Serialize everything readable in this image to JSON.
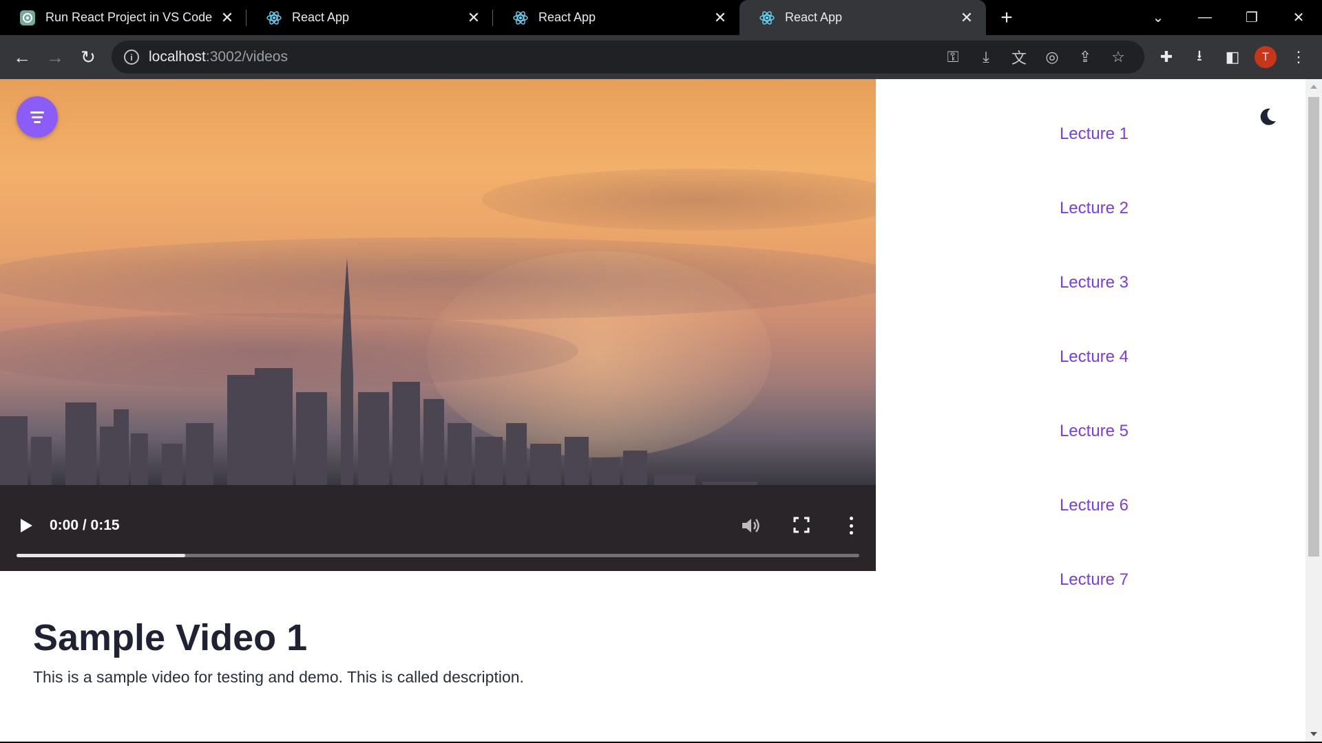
{
  "browser": {
    "tabs": [
      {
        "title": "Run React Project in VS Code",
        "icon": "chatgpt-icon",
        "active": false
      },
      {
        "title": "React App",
        "icon": "react-icon",
        "active": false
      },
      {
        "title": "React App",
        "icon": "react-icon",
        "active": false
      },
      {
        "title": "React App",
        "icon": "react-icon",
        "active": true
      }
    ],
    "new_tab_label": "+",
    "url_host": "localhost",
    "url_path": ":3002/videos",
    "profile_initial": "T",
    "accent_color": "#c8361a"
  },
  "page": {
    "video": {
      "time_display": "0:00 / 0:15",
      "progress_fraction": 0.2
    },
    "video_title": "Sample Video 1",
    "video_description": "This is a sample video for testing and demo. This is called description.",
    "lectures": [
      {
        "label": "Lecture 1"
      },
      {
        "label": "Lecture 2"
      },
      {
        "label": "Lecture 3"
      },
      {
        "label": "Lecture 4"
      },
      {
        "label": "Lecture 5"
      },
      {
        "label": "Lecture 6"
      },
      {
        "label": "Lecture 7"
      }
    ],
    "colors": {
      "accent": "#8b5cf6",
      "lecture_link": "#7c3aed",
      "title_text": "#1f2233"
    }
  }
}
